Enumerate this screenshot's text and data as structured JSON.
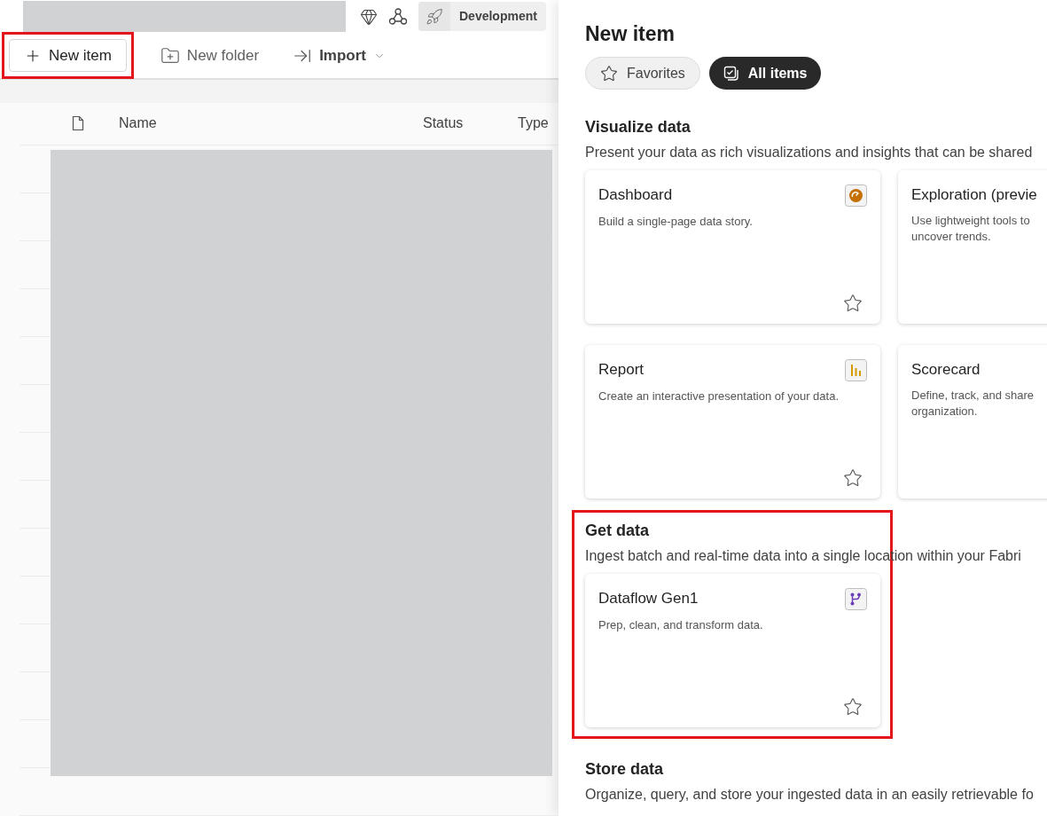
{
  "header": {
    "workspace_badge": "Development"
  },
  "toolbar": [
    {
      "kind": "new",
      "label": "New item",
      "highlighted": true
    },
    {
      "kind": "folder",
      "label": "New folder",
      "highlighted": false
    },
    {
      "kind": "import",
      "label": "Import",
      "highlighted": false
    }
  ],
  "table": {
    "columns": [
      "Name",
      "Status",
      "Type"
    ]
  },
  "panel": {
    "title": "New item",
    "filters": [
      {
        "kind": "favorites",
        "label": "Favorites",
        "selected": false
      },
      {
        "kind": "all",
        "label": "All items",
        "selected": true
      }
    ],
    "sections": [
      {
        "title": "Visualize data",
        "description": "Present your data as rich visualizations and insights that can be shared",
        "highlighted": false,
        "cards": [
          {
            "title": "Dashboard",
            "description": "Build a single-page data story.",
            "kind": "gauge"
          },
          {
            "title": "Exploration (previe",
            "description": "Use lightweight tools to\nuncover trends."
          },
          {
            "title": "Report",
            "description": "Create an interactive presentation of your data.",
            "kind": "bars"
          },
          {
            "title": "Scorecard",
            "description": "Define, track, and share\norganization."
          }
        ]
      },
      {
        "title": "Get data",
        "description": "Ingest batch and real-time data into a single location within your Fabri",
        "highlighted": true,
        "cards": [
          {
            "title": "Dataflow Gen1",
            "description": "Prep, clean, and transform data.",
            "kind": "branch"
          }
        ]
      },
      {
        "title": "Store data",
        "description": "Organize, query, and store your ingested data in an easily retrievable fo",
        "highlighted": false
      }
    ]
  }
}
